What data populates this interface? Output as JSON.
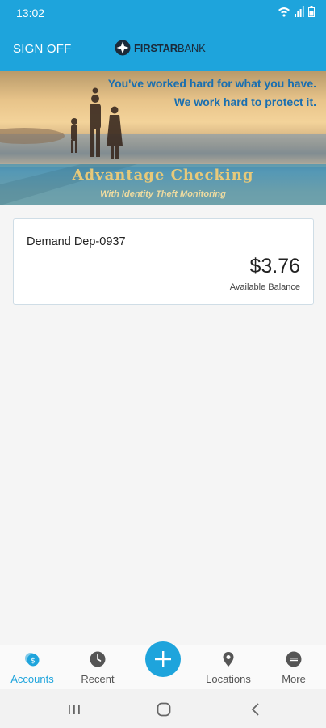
{
  "status_bar": {
    "time": "13:02",
    "icons": [
      "wifi-icon",
      "signal-icon",
      "battery-icon"
    ]
  },
  "header": {
    "sign_off_label": "SIGN OFF",
    "logo_bold": "FIRSTAR",
    "logo_light": "BANK"
  },
  "banner": {
    "tagline_1": "You've worked hard for what you have.",
    "tagline_2": "We work hard to protect it.",
    "title": "Advantage Checking",
    "subtitle": "With Identity Theft Monitoring"
  },
  "accounts": [
    {
      "name": "Demand Dep-0937",
      "balance": "$3.76",
      "balance_label": "Available Balance"
    }
  ],
  "bottom_nav": {
    "items": [
      {
        "label": "Accounts",
        "icon": "accounts-icon",
        "active": true
      },
      {
        "label": "Recent",
        "icon": "clock-icon",
        "active": false
      },
      {
        "label": "Locations",
        "icon": "location-pin-icon",
        "active": false
      },
      {
        "label": "More",
        "icon": "more-icon",
        "active": false
      }
    ],
    "fab_icon": "plus-icon"
  },
  "system_nav": {
    "buttons": [
      "recent-apps-icon",
      "home-icon",
      "back-icon"
    ]
  },
  "colors": {
    "primary": "#1ea4dc",
    "card_border": "#cfdde6",
    "banner_text": "#1a6fb0",
    "banner_title": "#e7c97a"
  }
}
